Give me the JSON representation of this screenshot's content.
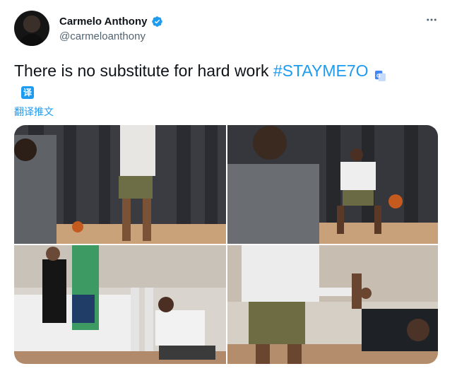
{
  "tweet": {
    "author": {
      "display_name": "Carmelo Anthony",
      "handle": "@carmeloanthony",
      "verified": true,
      "avatar_icon": "avatar-photo"
    },
    "text_main": "There is no substitute for hard work ",
    "hashtag": "#STAYME7O",
    "translate_badge": "译",
    "translate_link": "翻译推文",
    "more_icon": "more-horizontal-icon",
    "media": [
      {
        "name": "photo-drill-gym"
      },
      {
        "name": "photo-dribble-court"
      },
      {
        "name": "photo-kids-stretch"
      },
      {
        "name": "photo-high-five"
      }
    ]
  },
  "colors": {
    "accent": "#1d9bf0",
    "text": "#0f1419",
    "muted": "#536471"
  }
}
